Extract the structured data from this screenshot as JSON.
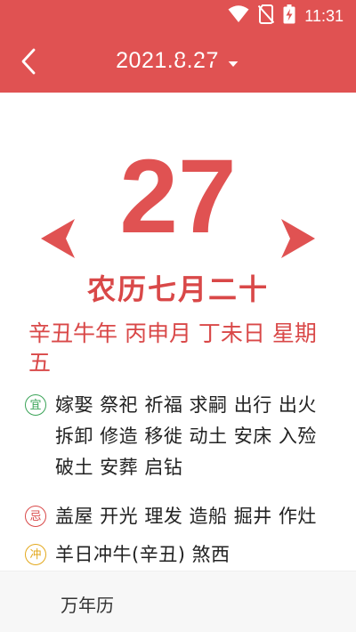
{
  "status_bar": {
    "time": "11:31",
    "icons": [
      "wifi-icon",
      "no-sim-icon",
      "battery-charging-icon"
    ]
  },
  "header": {
    "date": "2021.8.27",
    "back_icon": "back-arrow-icon",
    "dropdown_icon": "caret-down-icon",
    "background_color": "#e05252"
  },
  "day": {
    "number": "27",
    "prev_icon": "triangle-left-icon",
    "next_icon": "triangle-right-icon"
  },
  "lunar": {
    "date": "农历七月二十",
    "ganzhi": "辛丑牛年 丙申月 丁未日 星期五"
  },
  "almanac": {
    "yi": {
      "badge": "宜",
      "text": "嫁娶 祭祀 祈福 求嗣 出行 出火 拆卸 修造 移徙 动土 安床 入殓 破土 安葬 启钻",
      "color": "#3aa357"
    },
    "ji": {
      "badge": "忌",
      "text": "盖屋 开光 理发 造船 掘井 作灶",
      "color": "#d94848"
    },
    "chong": {
      "badge": "冲",
      "text": "羊日冲牛(辛丑) 煞西",
      "color": "#e3a81c"
    }
  },
  "bottom_tabs": {
    "tab1_label": "万年历",
    "accent_color": "#e05252"
  }
}
